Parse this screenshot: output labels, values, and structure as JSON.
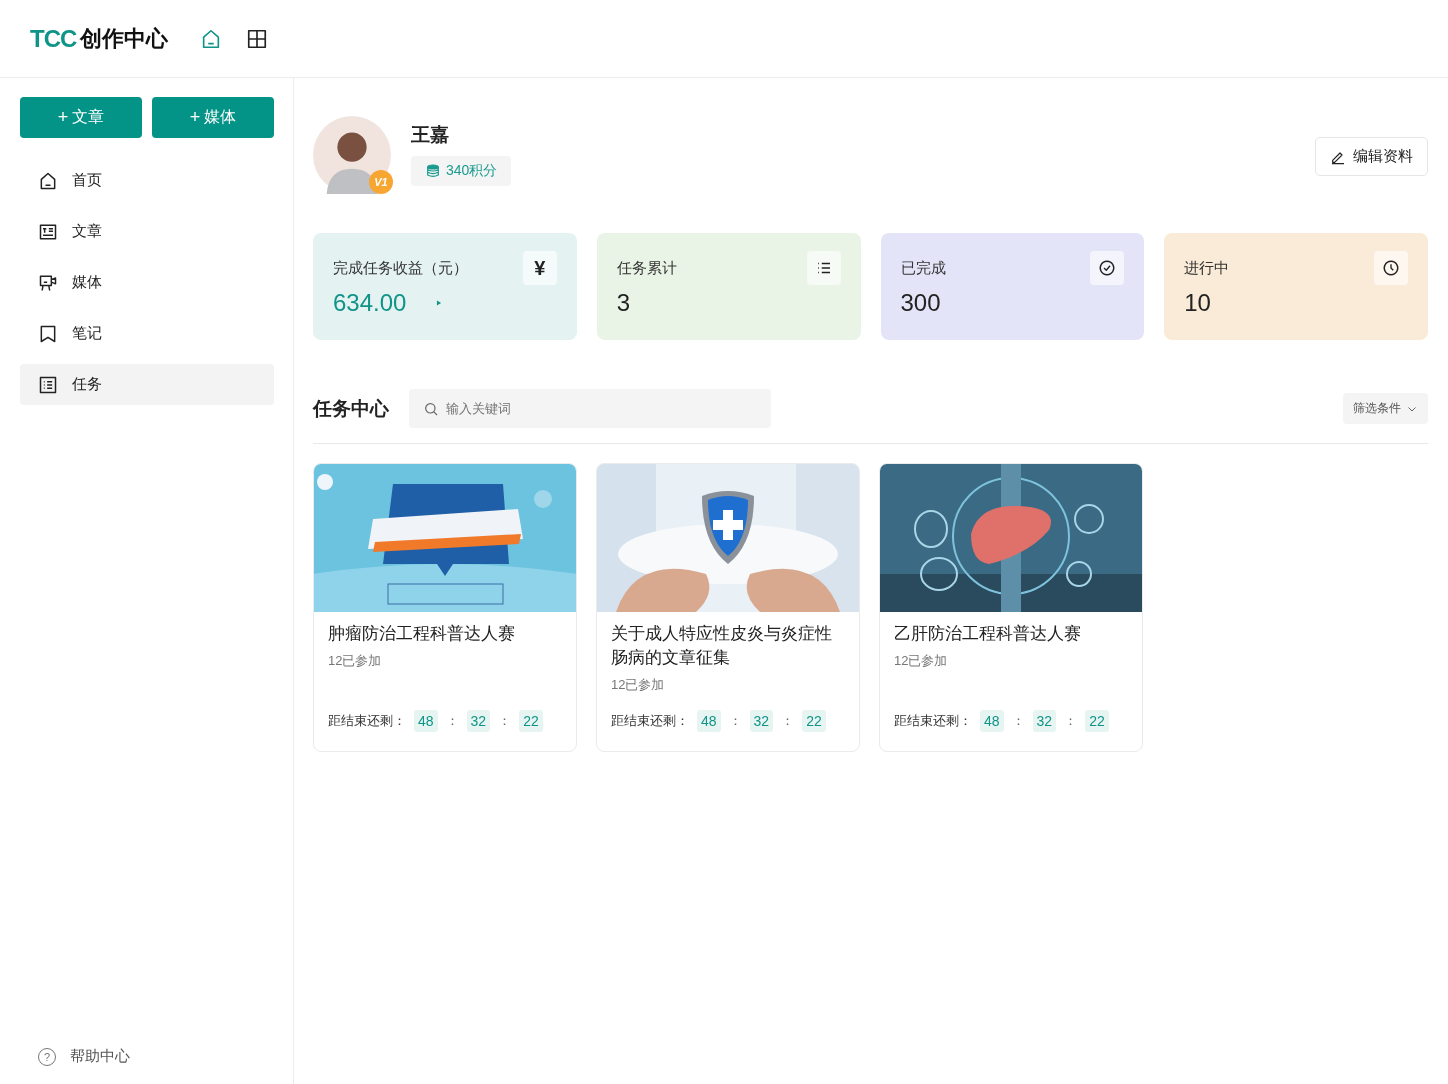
{
  "header": {
    "logo_mark": "TCC",
    "logo_title": "创作中心",
    "icons": [
      {
        "kind": "home",
        "selected": true
      },
      {
        "kind": "grid",
        "selected": false
      }
    ]
  },
  "sidebar": {
    "buttons": [
      {
        "icon": "+",
        "label": "文章"
      },
      {
        "icon": "+",
        "label": "媒体"
      }
    ],
    "items": [
      {
        "kind": "home",
        "label": "首页",
        "selected": false
      },
      {
        "kind": "article",
        "label": "文章",
        "selected": false
      },
      {
        "kind": "media",
        "label": "媒体",
        "selected": false
      },
      {
        "kind": "note",
        "label": "笔记",
        "selected": false
      },
      {
        "kind": "task",
        "label": "任务",
        "selected": true
      }
    ],
    "help": {
      "icon": "?",
      "label": "帮助中心"
    }
  },
  "profile": {
    "name": "王嘉",
    "level_badge": "V1",
    "points": "340积分",
    "edit_button": "编辑资料"
  },
  "stats": [
    {
      "label": "完成任务收益（元）",
      "value": "634.00",
      "icon_text": "¥",
      "kind": "money",
      "color": "#e5f2f2"
    },
    {
      "label": "任务累计",
      "value": "3",
      "kind": "total",
      "color": "#eaf4e6"
    },
    {
      "label": "已完成",
      "value": "300",
      "kind": "done",
      "color": "#e3e4f7"
    },
    {
      "label": "进行中",
      "value": "10",
      "kind": "ongoing",
      "color": "#f9ebd7"
    }
  ],
  "tasks": {
    "title": "任务中心",
    "search": {
      "placeholder": "输入关键词"
    },
    "filter": "筛选条件",
    "cards": [
      {
        "image": {
          "kind": "picture"
        },
        "title": "肿瘤防治工程科普达人赛",
        "joined": "12已参加",
        "countdown_label": "距结束还剩：",
        "countdown": [
          "48",
          "32",
          "22"
        ],
        "separator": "："
      },
      {
        "image": {
          "kind": "picture"
        },
        "title": "关于成人特应性皮炎与炎症性肠病的文章征集",
        "joined": "12已参加",
        "countdown_label": "距结束还剩：",
        "countdown": [
          "48",
          "32",
          "22"
        ],
        "separator": "："
      },
      {
        "image": {
          "kind": "picture"
        },
        "title": "乙肝防治工程科普达人赛",
        "joined": "12已参加",
        "countdown_label": "距结束还剩：",
        "countdown": [
          "48",
          "32",
          "22"
        ],
        "separator": "："
      }
    ]
  }
}
